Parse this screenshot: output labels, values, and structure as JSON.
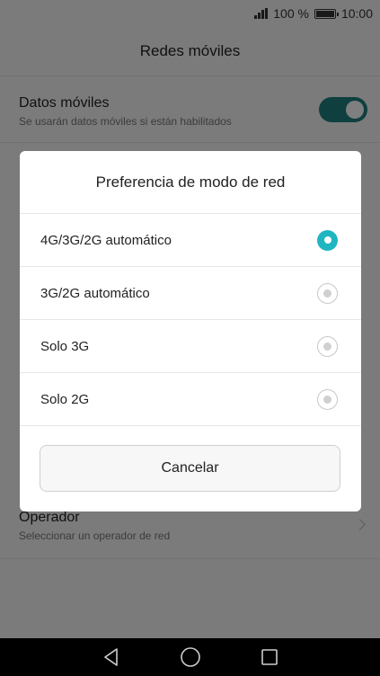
{
  "status_bar": {
    "battery": "100 %",
    "time": "10:00"
  },
  "header": {
    "title": "Redes móviles"
  },
  "settings": {
    "datos_moviles": {
      "title": "Datos móviles",
      "subtitle": "Se usarán datos móviles si están habilitados"
    },
    "operador": {
      "title": "Operador",
      "subtitle": "Seleccionar un operador de red"
    }
  },
  "dialog": {
    "title": "Preferencia de modo de red",
    "options": [
      {
        "label": "4G/3G/2G automático",
        "selected": true
      },
      {
        "label": "3G/2G automático",
        "selected": false
      },
      {
        "label": "Solo 3G",
        "selected": false
      },
      {
        "label": "Solo 2G",
        "selected": false
      }
    ],
    "cancel_label": "Cancelar"
  },
  "colors": {
    "accent": "#1fb6c1",
    "toggle_on": "#1f7f7f"
  }
}
